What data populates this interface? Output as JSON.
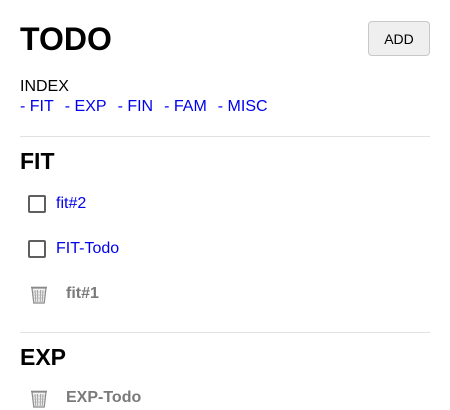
{
  "header": {
    "title": "TODO",
    "add_label": "ADD"
  },
  "index": {
    "label": "INDEX",
    "links": [
      "- FIT",
      "- EXP",
      "- FIN",
      "- FAM",
      "- MISC"
    ]
  },
  "sections": [
    {
      "title": "FIT",
      "open_todos": [
        "fit#2",
        "FIT-Todo"
      ],
      "done_todos": [
        "fit#1"
      ]
    },
    {
      "title": "EXP",
      "open_todos": [],
      "done_todos": [
        "EXP-Todo"
      ]
    }
  ],
  "icons": {
    "checkbox": "checkbox-icon",
    "trash": "trash-icon"
  },
  "colors": {
    "link": "#0000ee",
    "done_text": "#7a7a7a",
    "divider": "#e2e2e2",
    "button_bg": "#efefef"
  }
}
